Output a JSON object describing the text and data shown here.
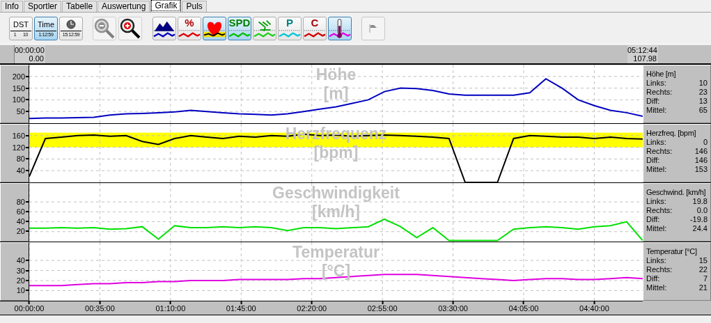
{
  "tabs": [
    {
      "label": "Info",
      "selected": false
    },
    {
      "label": "Sportler",
      "selected": false
    },
    {
      "label": "Tabelle",
      "selected": false
    },
    {
      "label": "Auswertung",
      "selected": false
    },
    {
      "label": "Grafik",
      "selected": true
    },
    {
      "label": "Puls",
      "selected": false
    }
  ],
  "toolbar": {
    "view_buttons": [
      {
        "kind": "scale",
        "label": "DST",
        "scale_labels": [
          "1",
          "10"
        ],
        "selected": false
      },
      {
        "kind": "scale",
        "label": "Time",
        "scale_labels": [
          "1:12:59"
        ],
        "selected": true
      },
      {
        "kind": "clock",
        "scale_labels": [
          "15:12:59"
        ],
        "selected": false
      }
    ],
    "zoom_buttons": [
      {
        "kind": "zoom_out"
      },
      {
        "kind": "zoom_in"
      }
    ],
    "series_buttons": [
      {
        "kind": "altitude",
        "color": "#0000c0",
        "selected": false
      },
      {
        "kind": "letter",
        "label": "%",
        "color": "#e00000",
        "selected": false
      },
      {
        "kind": "heart",
        "color": "#f0e000",
        "selected": true
      },
      {
        "kind": "letter",
        "label": "SPD",
        "color": "#00c000",
        "selected": true
      },
      {
        "kind": "cadence",
        "color": "#20d020",
        "selected": false
      },
      {
        "kind": "letter",
        "label": "P",
        "color": "#00c8d8",
        "selected": false
      },
      {
        "kind": "letter",
        "label": "C",
        "color": "#d00000",
        "selected": false
      },
      {
        "kind": "thermometer",
        "color": "#e000e0",
        "selected": true
      }
    ],
    "marker_button": {
      "disabled": true
    }
  },
  "range": {
    "start_time": "00:00:00",
    "start_distance": "0.00",
    "end_time": "05:12:44",
    "end_distance": "107.98"
  },
  "panels": [
    {
      "title_lines": [
        "Höhe",
        "[m]"
      ],
      "stats_title": "Höhe [m]",
      "stats": [
        {
          "label": "Links:",
          "value": "10"
        },
        {
          "label": "Rechts:",
          "value": "23"
        },
        {
          "label": "Diff:",
          "value": "13"
        },
        {
          "label": "Mittel:",
          "value": "65"
        }
      ],
      "chart_data": {
        "type": "line",
        "grid": true,
        "ylim": [
          0,
          250
        ],
        "yticks": [
          50,
          100,
          150,
          200
        ],
        "categories": [
          null,
          null,
          null,
          null,
          null,
          null,
          null,
          null,
          null,
          null,
          null,
          null,
          null,
          null,
          null,
          null,
          null,
          null,
          null,
          null,
          null,
          null,
          null,
          null,
          null,
          null,
          null,
          null,
          null,
          null,
          null,
          null,
          null,
          null,
          null,
          null,
          null,
          null,
          null
        ],
        "series": [
          {
            "color": "#0000c0",
            "values": [
              20,
              22,
              22,
              24,
              25,
              35,
              40,
              42,
              45,
              48,
              55,
              50,
              45,
              40,
              38,
              35,
              40,
              50,
              60,
              70,
              85,
              100,
              135,
              150,
              148,
              140,
              125,
              120,
              120,
              120,
              120,
              130,
              190,
              150,
              100,
              75,
              55,
              45,
              30
            ]
          }
        ]
      }
    },
    {
      "title_lines": [
        "Herzfrequenz",
        "[bpm]"
      ],
      "stats_title": "Herzfreq. [bpm]",
      "stats": [
        {
          "label": "Links:",
          "value": "0"
        },
        {
          "label": "Rechts:",
          "value": "146"
        },
        {
          "label": "Diff:",
          "value": "146"
        },
        {
          "label": "Mittel:",
          "value": "153"
        }
      ],
      "chart_data": {
        "type": "line",
        "ylim": [
          0,
          200
        ],
        "yticks": [
          40,
          80,
          120,
          160
        ],
        "grid": true,
        "bands": [
          {
            "axis": "y",
            "from": 120,
            "to": 170,
            "color": "#ffff00"
          }
        ],
        "categories": [
          null,
          null,
          null,
          null,
          null,
          null,
          null,
          null,
          null,
          null,
          null,
          null,
          null,
          null,
          null,
          null,
          null,
          null,
          null,
          null,
          null,
          null,
          null,
          null,
          null,
          null,
          null,
          null,
          null,
          null,
          null,
          null,
          null,
          null,
          null,
          null,
          null,
          null,
          null
        ],
        "series": [
          {
            "color": "#000000",
            "values": [
              20,
              150,
              155,
              160,
              162,
              158,
              160,
              140,
              130,
              150,
              160,
              155,
              150,
              158,
              155,
              160,
              158,
              165,
              160,
              162,
              158,
              160,
              162,
              160,
              158,
              155,
              150,
              0,
              0,
              0,
              150,
              160,
              158,
              155,
              155,
              150,
              155,
              150,
              148
            ]
          }
        ]
      }
    },
    {
      "title_lines": [
        "Geschwindigkeit",
        "[km/h]"
      ],
      "stats_title": "Geschwind. [km/h]",
      "stats": [
        {
          "label": "Links:",
          "value": "19.8"
        },
        {
          "label": "Rechts:",
          "value": "0.0"
        },
        {
          "label": "Diff:",
          "value": "-19.8"
        },
        {
          "label": "Mittel:",
          "value": "24.4"
        }
      ],
      "chart_data": {
        "type": "line",
        "grid": true,
        "ylim": [
          0,
          118
        ],
        "yticks": [
          20,
          40,
          60,
          80
        ],
        "categories": [
          null,
          null,
          null,
          null,
          null,
          null,
          null,
          null,
          null,
          null,
          null,
          null,
          null,
          null,
          null,
          null,
          null,
          null,
          null,
          null,
          null,
          null,
          null,
          null,
          null,
          null,
          null,
          null,
          null,
          null,
          null,
          null,
          null,
          null,
          null,
          null,
          null,
          null,
          null
        ],
        "series": [
          {
            "color": "#00e000",
            "values": [
              27,
              27,
              28,
              27,
              28,
              25,
              26,
              30,
              5,
              32,
              28,
              28,
              30,
              28,
              30,
              28,
              22,
              28,
              28,
              26,
              28,
              30,
              45,
              30,
              8,
              28,
              2,
              2,
              2,
              2,
              25,
              28,
              30,
              28,
              25,
              30,
              32,
              40,
              2
            ]
          }
        ]
      }
    },
    {
      "title_lines": [
        "Temperatur",
        "[°C]"
      ],
      "stats_title": "Temperatur [°C]",
      "stats": [
        {
          "label": "Links:",
          "value": "15"
        },
        {
          "label": "Rechts:",
          "value": "22"
        },
        {
          "label": "Diff:",
          "value": "7"
        },
        {
          "label": "Mittel:",
          "value": "21"
        }
      ],
      "chart_data": {
        "type": "line",
        "grid": true,
        "xlim": [
          0,
          304
        ],
        "ylim": [
          0,
          58
        ],
        "yticks": [
          10,
          20,
          30,
          40
        ],
        "xticks": [
          {
            "value": 0,
            "label": "00:00:00"
          },
          {
            "value": 35,
            "label": "00:35:00"
          },
          {
            "value": 70,
            "label": "01:10:00"
          },
          {
            "value": 105,
            "label": "01:45:00"
          },
          {
            "value": 140,
            "label": "02:20:00"
          },
          {
            "value": 175,
            "label": "02:55:00"
          },
          {
            "value": 210,
            "label": "03:30:00"
          },
          {
            "value": 245,
            "label": "04:05:00"
          },
          {
            "value": 280,
            "label": "04:40:00"
          }
        ],
        "x": [
          0,
          8,
          16,
          24,
          32,
          40,
          48,
          56,
          64,
          72,
          80,
          88,
          96,
          104,
          112,
          120,
          128,
          136,
          144,
          152,
          160,
          168,
          176,
          184,
          192,
          200,
          208,
          216,
          224,
          232,
          240,
          248,
          256,
          264,
          272,
          280,
          288,
          296,
          304
        ],
        "series": [
          {
            "color": "#e000e0",
            "values": [
              15,
              15,
              15,
              16,
              17,
              17,
              18,
              18,
              19,
              19,
              20,
              20,
              20,
              21,
              21,
              21,
              21,
              22,
              22,
              23,
              24,
              25,
              26,
              26,
              26,
              25,
              24,
              23,
              22,
              21,
              20,
              21,
              22,
              22,
              21,
              21,
              22,
              23,
              22
            ]
          }
        ]
      }
    }
  ]
}
